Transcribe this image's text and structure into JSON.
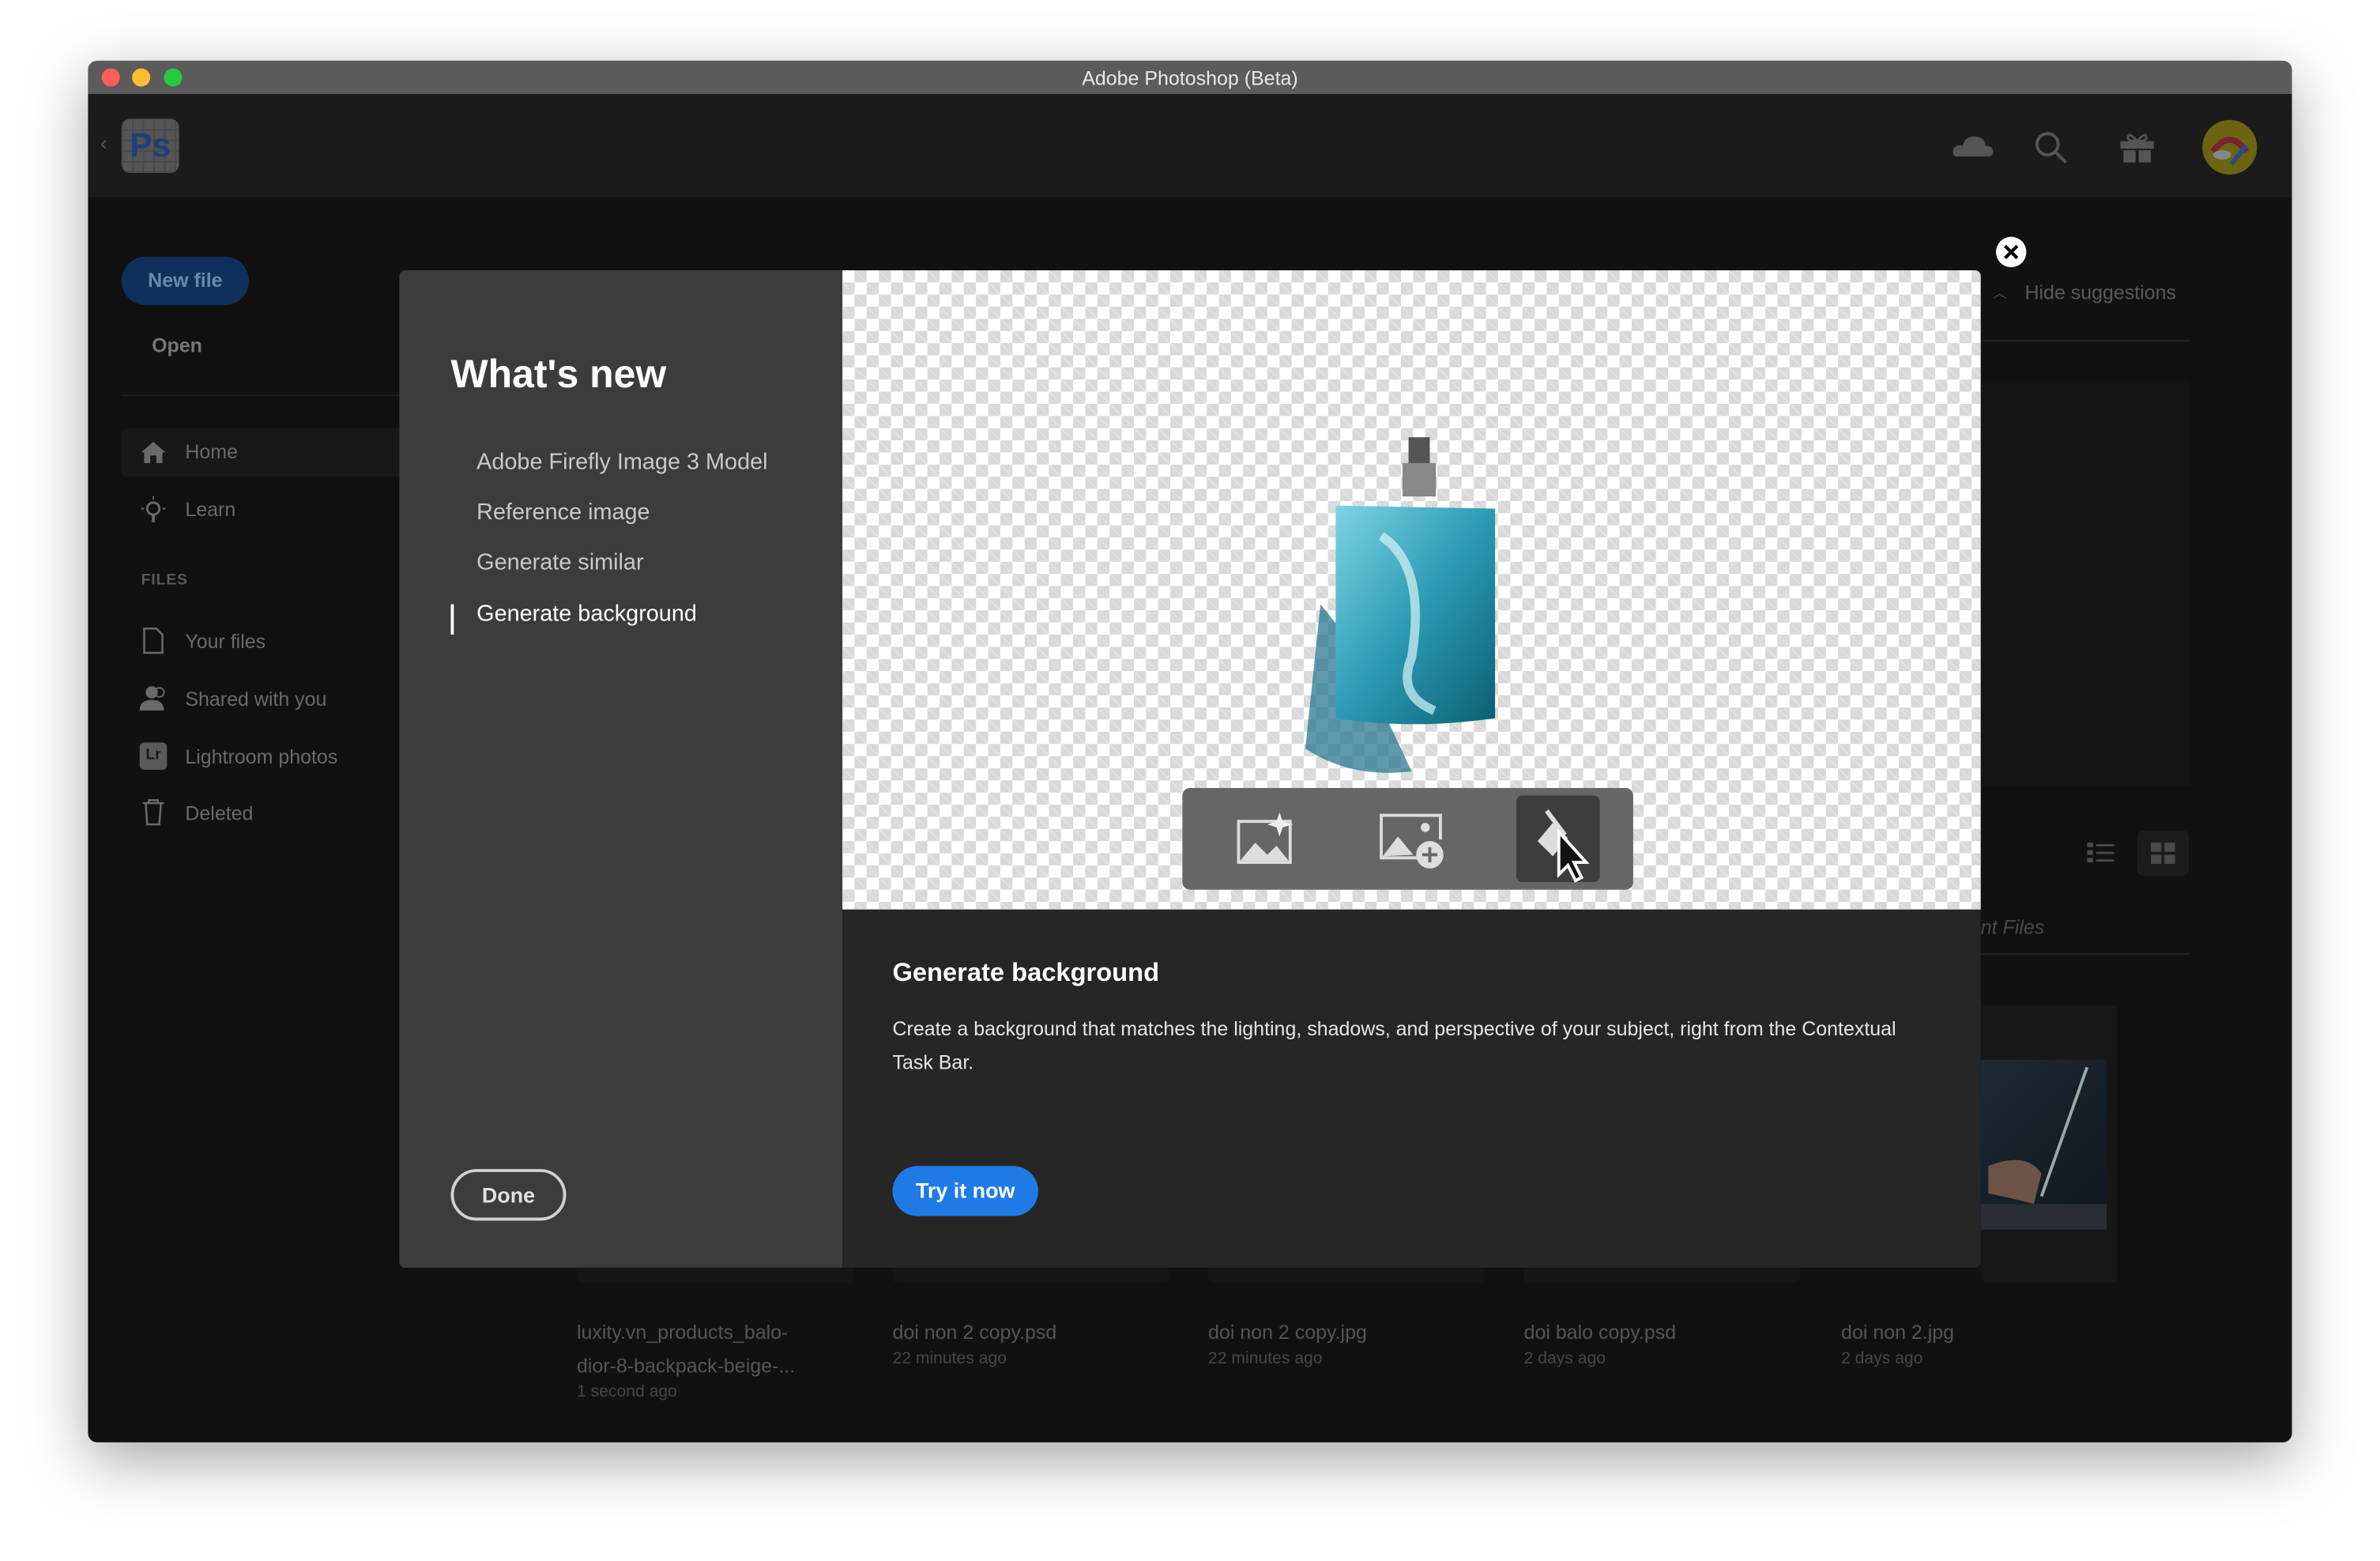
{
  "window": {
    "title": "Adobe Photoshop (Beta)"
  },
  "appbar": {
    "logo": "Ps",
    "icons": [
      "cloud-icon",
      "search-icon",
      "gift-icon",
      "avatar"
    ]
  },
  "sidebar": {
    "new_file": "New file",
    "open": "Open",
    "items": [
      {
        "label": "Home",
        "icon": "home-icon"
      },
      {
        "label": "Learn",
        "icon": "lightbulb-icon"
      }
    ],
    "files_heading": "FILES",
    "file_items": [
      {
        "label": "Your files",
        "icon": "file-icon"
      },
      {
        "label": "Shared with you",
        "icon": "people-icon"
      },
      {
        "label": "Lightroom photos",
        "icon": "lightroom-icon",
        "badge": "Lr"
      },
      {
        "label": "Deleted",
        "icon": "trash-icon"
      }
    ]
  },
  "main": {
    "hide_suggestions": "Hide suggestions",
    "recent_files_partial": "nt Files",
    "files": [
      {
        "name": "luxity.vn_products_balo-dior-8-backpack-beige-...",
        "time": "1 second ago"
      },
      {
        "name": "doi non 2 copy.psd",
        "time": "22 minutes ago"
      },
      {
        "name": "doi non 2 copy.jpg",
        "time": "22 minutes ago"
      },
      {
        "name": "doi balo copy.psd",
        "time": "2 days ago"
      },
      {
        "name": "doi non 2.jpg",
        "time": "2 days ago"
      }
    ]
  },
  "modal": {
    "title": "What's new",
    "nav": [
      "Adobe Firefly Image 3 Model",
      "Reference image",
      "Generate similar",
      "Generate background"
    ],
    "active_index": 3,
    "done": "Done",
    "feature_title": "Generate background",
    "feature_desc": "Create a background that matches the lighting, shadows, and perspective of your subject, right from the Contextual Task Bar.",
    "try_now": "Try it now",
    "taskbar_icons": [
      "generative-fill-icon",
      "add-image-icon",
      "generate-background-icon"
    ],
    "colors": {
      "accent": "#1f7ae8",
      "panel": "#3c3c3c",
      "content": "#262626"
    }
  }
}
